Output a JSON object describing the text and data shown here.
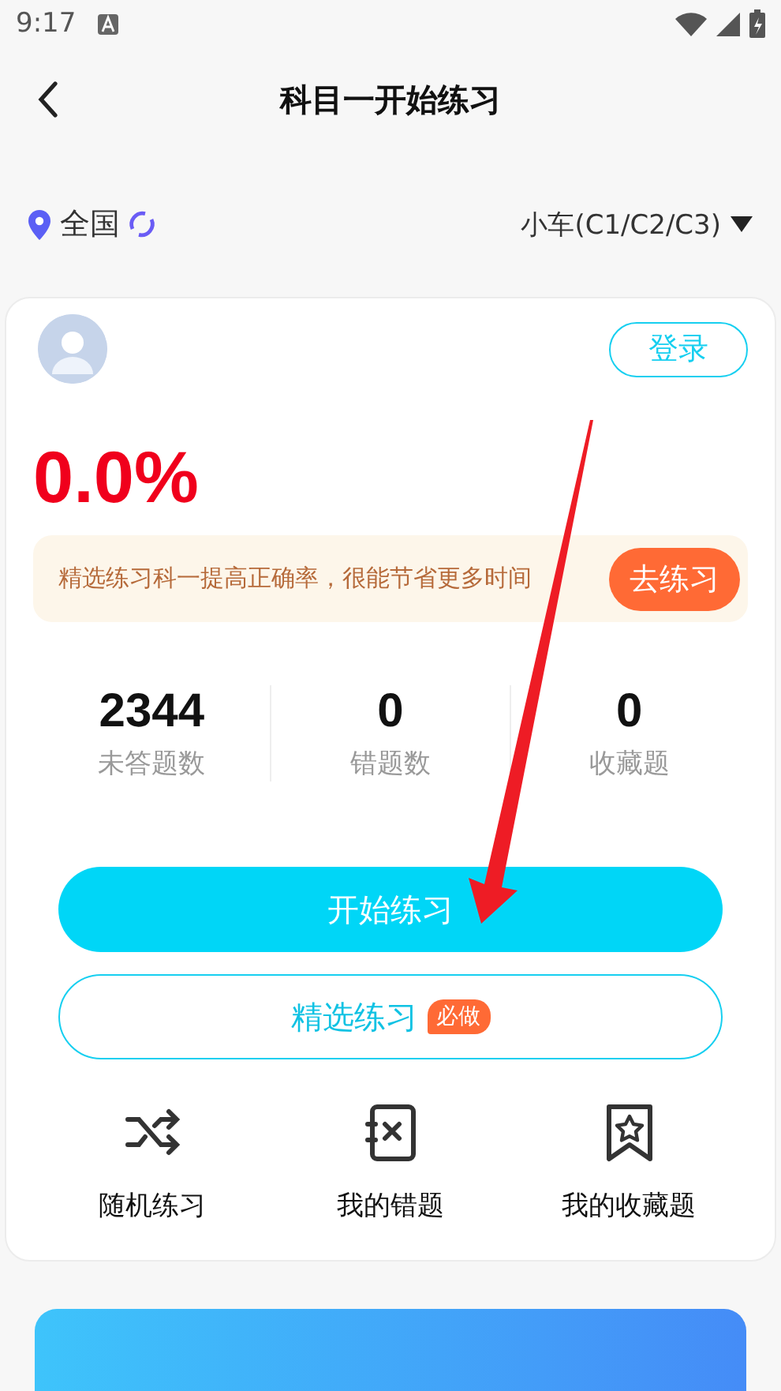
{
  "status_bar": {
    "time": "9:17"
  },
  "header": {
    "title": "科目一开始练习"
  },
  "filter": {
    "region": "全国",
    "vehicle": "小车(C1/C2/C3)"
  },
  "card": {
    "login": "登录",
    "accuracy": "0.0%",
    "tip": {
      "text": "精选练习科一提高正确率，很能节省更多时间",
      "action": "去练习"
    },
    "stats": [
      {
        "value": "2344",
        "label": "未答题数"
      },
      {
        "value": "0",
        "label": "错题数"
      },
      {
        "value": "0",
        "label": "收藏题"
      }
    ],
    "primary_button": "开始练习",
    "secondary_button": {
      "label": "精选练习",
      "badge": "必做"
    },
    "shortcuts": [
      {
        "kind": "shuffle",
        "label": "随机练习"
      },
      {
        "kind": "wrong",
        "label": "我的错题"
      },
      {
        "kind": "favorite",
        "label": "我的收藏题"
      }
    ]
  },
  "annotation": {
    "kind": "arrow"
  }
}
